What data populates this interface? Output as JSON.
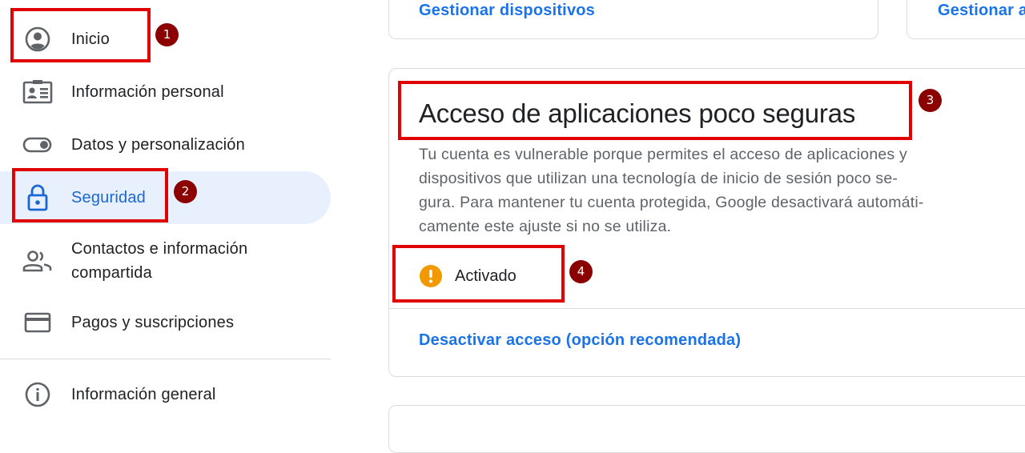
{
  "sidebar": {
    "items": [
      {
        "label": "Inicio",
        "icon": "account-circle-icon"
      },
      {
        "label": "Información personal",
        "icon": "id-card-icon"
      },
      {
        "label": "Datos y personalización",
        "icon": "toggle-icon"
      },
      {
        "label": "Seguridad",
        "icon": "lock-icon"
      },
      {
        "label": "Contactos e información compartida",
        "icon": "people-icon"
      },
      {
        "label": "Pagos y suscripciones",
        "icon": "credit-card-icon"
      },
      {
        "label": "Información general",
        "icon": "info-icon"
      }
    ],
    "active": "Seguridad"
  },
  "top_cards": {
    "left_link": "Gestionar dispositivos",
    "right_link": "Gestionar a"
  },
  "less_secure_apps": {
    "title": "Acceso de aplicaciones poco seguras",
    "description": "Tu cuenta es vulnerable porque permites el acceso de aplicaciones y dispositivos que utilizan una tecnología de inicio de sesión poco segura. Para mantener tu cuenta protegida, Google desactivará automáticamente este ajuste si no se utiliza.",
    "description_lines": [
      "Tu cuenta es vulnerable porque permites el acceso de aplicaciones y",
      "dispositivos que utilizan una tecnología de inicio de sesión poco se-",
      "gura. Para mantener tu cuenta protegida, Google desactivará automáti-",
      "camente este ajuste si no se utiliza."
    ],
    "status": {
      "label": "Activado",
      "icon": "warning-icon",
      "color": "#f29900"
    },
    "action_link": "Desactivar acceso (opción recomendada)"
  },
  "annotations": {
    "color": "#e00000",
    "badges": [
      "1",
      "2",
      "3",
      "4"
    ]
  },
  "colors": {
    "accent": "#1a73e8",
    "active_bg": "#e8f0fe",
    "active_text": "#1967d2"
  }
}
